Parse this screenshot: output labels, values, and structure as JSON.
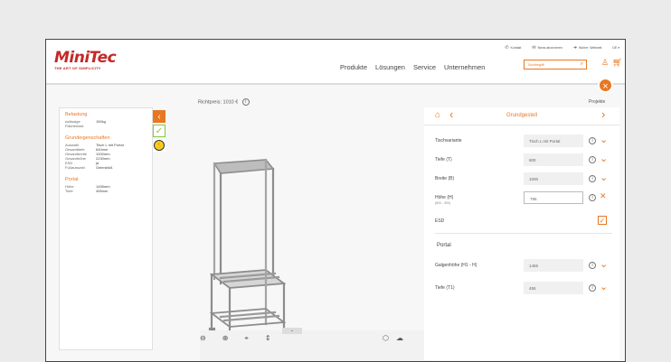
{
  "header": {
    "logo_name": "MiniTec",
    "logo_tagline": "THE ART OF SIMPLICITY",
    "utility": [
      {
        "icon": "phone-icon",
        "glyph": "✆",
        "label": "Kontakt"
      },
      {
        "icon": "mail-icon",
        "glyph": "✉",
        "label": "News abonnieren"
      },
      {
        "icon": "arrow-icon",
        "glyph": "➜",
        "label": "Woher: Weltweit"
      },
      {
        "icon": "language-icon",
        "glyph": "",
        "label": "DE ▾"
      }
    ],
    "nav": [
      "Produkte",
      "Lösungen",
      "Service",
      "Unternehmen"
    ],
    "search_placeholder": "Suchbegriff",
    "user_icon": "user-icon",
    "cart_icon": "cart-icon"
  },
  "dialog": {
    "projekte_label": "Projekte",
    "price_label": "Richtpreis: 1010 € ",
    "info_glyph": "i"
  },
  "left_panel": {
    "belastung_title": "Belastung",
    "belastung_rows": [
      {
        "k": "zulässige Flächenlast",
        "v": "150kg"
      }
    ],
    "grund_title": "Grundeigenschaften",
    "grund_rows": [
      {
        "k": "Auswahl",
        "v": "Tisch L mit Portal"
      },
      {
        "k": "Gesamttiefe",
        "v": "640mm"
      },
      {
        "k": "Gesamtbreite",
        "v": "1000mm"
      },
      {
        "k": "Gesamthöhe",
        "v": "2230mm"
      },
      {
        "k": "ESD",
        "v": "ja"
      },
      {
        "k": "Fußauswahl",
        "v": "Gelenkfuß"
      }
    ],
    "portal_title": "Portal",
    "portal_rows": [
      {
        "k": "Höhe",
        "v": "1455mm"
      },
      {
        "k": "Tiefe",
        "v": "455mm"
      }
    ]
  },
  "right_panel": {
    "title": "Grundgestell",
    "rows": [
      {
        "label": "Tischvariante",
        "sub": "",
        "value": "Tisch L mit Portal",
        "action": "chevron"
      },
      {
        "label": "Tiefe (T)",
        "sub": "",
        "value": "600",
        "action": "chevron"
      },
      {
        "label": "Breite (B)",
        "sub": "",
        "value": "1000",
        "action": "chevron"
      },
      {
        "label": "Höhe (H)",
        "sub": "(600 - 900)",
        "value": "795",
        "action": "close"
      },
      {
        "label": "ESD",
        "sub": "",
        "value": "",
        "action": "check"
      }
    ],
    "portal_title": "Portal",
    "portal_rows": [
      {
        "label": "Galgenhöhe (H1 - H)",
        "value": "1455",
        "action": "chevron"
      },
      {
        "label": "Tiefe (T1)",
        "value": "455",
        "action": "chevron"
      }
    ]
  },
  "colors": {
    "accent": "#e87722",
    "logo": "#c42828",
    "ok": "#8cc63f",
    "esd": "#f7d117"
  }
}
